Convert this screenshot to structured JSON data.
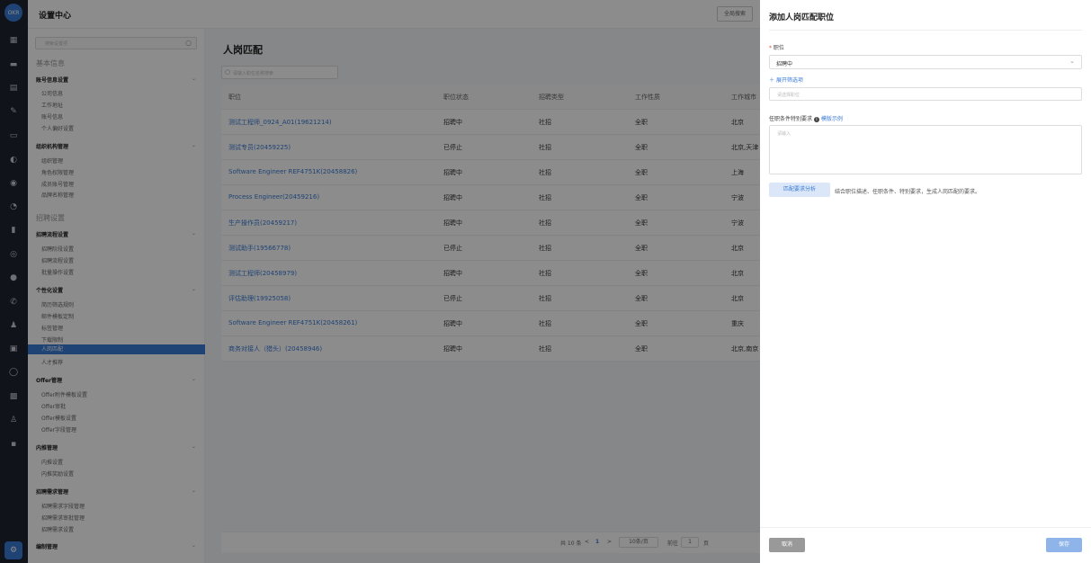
{
  "app": {
    "title": "设置中心",
    "global_search": "全局搜索",
    "logo": "OKR"
  },
  "sidebar": {
    "search_placeholder": "搜索设置项",
    "sections": [
      "基本信息",
      "招聘设置"
    ],
    "groups": [
      {
        "title": "账号信息设置",
        "items": [
          "公司信息",
          "工作地址",
          "账号信息",
          "个人偏好设置"
        ]
      },
      {
        "title": "组织机构管理",
        "items": [
          "组织管理",
          "角色权限管理",
          "成员账号管理",
          "品牌名称管理"
        ]
      },
      {
        "title": "招聘流程设置",
        "items": [
          "招聘阶段设置",
          "招聘流程设置",
          "批量操作设置"
        ]
      },
      {
        "title": "个性化设置",
        "items": [
          "简历筛选规则",
          "邮件模板定制",
          "标签管理",
          "下载限制",
          "人岗匹配",
          "人才推荐"
        ]
      },
      {
        "title": "Offer管理",
        "items": [
          "Offer附件模板设置",
          "Offer审批",
          "Offer模板设置",
          "Offer字段管理"
        ]
      },
      {
        "title": "内推管理",
        "items": [
          "内推设置",
          "内推奖励设置"
        ]
      },
      {
        "title": "招聘需求管理",
        "items": [
          "招聘需求字段管理",
          "招聘需求审批管理",
          "招聘需求设置"
        ]
      },
      {
        "title": "编制管理",
        "items": []
      }
    ],
    "active_item": "人岗匹配"
  },
  "main": {
    "title": "人岗匹配",
    "search_placeholder": "请输入职位名称搜索",
    "columns": [
      "职位",
      "职位状态",
      "招聘类型",
      "工作性质",
      "工作城市"
    ],
    "rows": [
      [
        "测试工程师_0924_A01(19621214)",
        "招聘中",
        "社招",
        "全职",
        "北京"
      ],
      [
        "测试专员(20459225)",
        "已停止",
        "社招",
        "全职",
        "北京,天津"
      ],
      [
        "Software Engineer REF4751K(20458826)",
        "招聘中",
        "社招",
        "全职",
        "上海"
      ],
      [
        "Process Engineer(20459216)",
        "招聘中",
        "社招",
        "全职",
        "宁波"
      ],
      [
        "生产操作员(20459217)",
        "招聘中",
        "社招",
        "全职",
        "宁波"
      ],
      [
        "测试助手(19566778)",
        "已停止",
        "社招",
        "全职",
        "北京"
      ],
      [
        "测试工程师(20458979)",
        "招聘中",
        "社招",
        "全职",
        "北京"
      ],
      [
        "评估助理(19925058)",
        "已停止",
        "社招",
        "全职",
        "北京"
      ],
      [
        "Software Engineer REF4751K(20458261)",
        "招聘中",
        "社招",
        "全职",
        "重庆"
      ],
      [
        "商务对接人（猎头）(20458946)",
        "招聘中",
        "社招",
        "全职",
        "北京,南京"
      ]
    ],
    "pagination": {
      "total": "共 10 条",
      "prev": "<",
      "page": "1",
      "next": ">",
      "page_size": "10条/页",
      "goto_label": "前往",
      "goto_value": "1",
      "goto_suffix": "页"
    }
  },
  "drawer": {
    "title": "添加人岗匹配职位",
    "position_label": "职位",
    "required_mark": "*",
    "position_select": "招聘中",
    "expand_filter": "展开筛选项",
    "position_search_placeholder": "请选择职位",
    "requirement_label": "任职条件特别要求",
    "requirement_example": "模版示例",
    "requirement_placeholder": "请输入",
    "analyze_button": "匹配要求分析",
    "analyze_hint": "结合职位描述、任职条件、特别要求，生成人岗匹配的要求。",
    "cancel": "取消",
    "save": "保存"
  },
  "colors": {
    "accent": "#3a7bd5",
    "rail": "#1f2430",
    "overlay": "rgba(0,0,0,0.45)"
  },
  "icons": [
    "logo-icon",
    "grid-icon",
    "home-icon",
    "doc-icon",
    "chart-icon",
    "setting-icon"
  ]
}
